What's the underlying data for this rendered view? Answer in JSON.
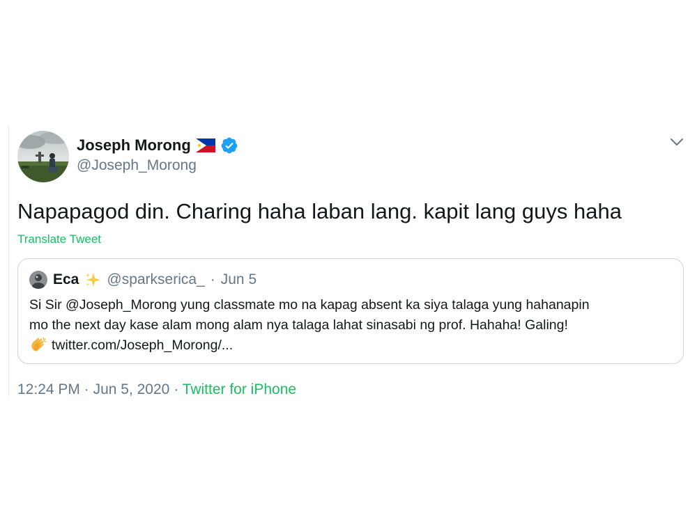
{
  "tweet": {
    "author": {
      "name": "Joseph Morong",
      "handle": "@Joseph_Morong",
      "flag_icon": "philippines-flag-icon",
      "verified_icon": "verified-badge-icon"
    },
    "text": "Napapagod din. Charing haha laban lang. kapit lang guys haha",
    "translate_label": "Translate Tweet",
    "menu_icon": "chevron-down-icon",
    "quoted": {
      "name": "Eca",
      "name_icon": "sparkles-icon",
      "handle": "@sparkserica_",
      "separator": "·",
      "date": "Jun 5",
      "lines": [
        "Si Sir @Joseph_Morong yung classmate mo na kapag absent ka siya talaga yung hahanapin",
        "mo the next day kase alam mong alam nya talaga lahat sinasabi ng prof. Hahaha! Galing!"
      ],
      "link_icon": "clapping-hands-icon",
      "link": "twitter.com/Joseph_Morong/..."
    },
    "meta": {
      "time": "12:24 PM",
      "sep1": "·",
      "date": "Jun 5, 2020",
      "sep2": "·",
      "source": "Twitter for iPhone"
    }
  },
  "colors": {
    "text": "#14171a",
    "secondary": "#657786",
    "accent_green": "#17bf63",
    "verified_blue": "#1da1f2",
    "border": "#ccd6dd"
  }
}
